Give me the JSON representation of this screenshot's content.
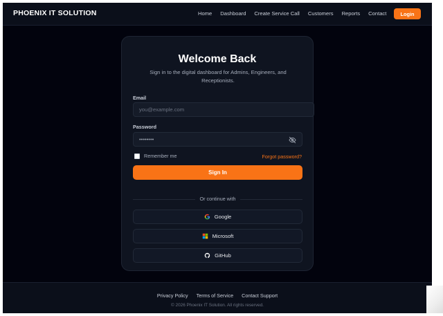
{
  "nav": {
    "brand": "PHOENIX IT SOLUTION",
    "links": [
      "Home",
      "Dashboard",
      "Create Service Call",
      "Customers",
      "Reports",
      "Contact"
    ],
    "login_label": "Login"
  },
  "card": {
    "title": "Welcome Back",
    "subtitle": "Sign in to the digital dashboard for Admins, Engineers, and Receptionists.",
    "email_label": "Email",
    "email_placeholder": "you@example.com",
    "password_label": "Password",
    "password_value": "••••••••",
    "remember_label": "Remember me",
    "forgot_label": "Forgot password?",
    "signin_label": "Sign In",
    "divider_text": "Or continue with",
    "social": [
      {
        "label": "Google",
        "icon": "google-icon"
      },
      {
        "label": "Microsoft",
        "icon": "microsoft-icon"
      },
      {
        "label": "GitHub",
        "icon": "github-icon"
      }
    ]
  },
  "footer": {
    "links": [
      "Privacy Policy",
      "Terms of Service",
      "Contact Support"
    ],
    "copyright": "© 2026 Phoenix IT Solution. All rights reserved."
  },
  "colors": {
    "accent": "#f97316",
    "background": "#02030d",
    "card": "#0f1420"
  }
}
